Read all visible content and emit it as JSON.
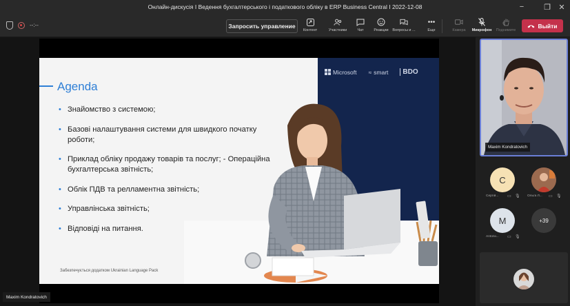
{
  "window": {
    "title": "Онлайн-дискусія І Ведення бухгалтерського і податкового обліку в ERP Business Central І 2022-12-08"
  },
  "toolbar": {
    "timer": "--:--",
    "take_control": "Запросить управление",
    "buttons": [
      {
        "label": "Контент",
        "icon": "share-content-icon"
      },
      {
        "label": "Участники",
        "icon": "people-icon"
      },
      {
        "label": "Чат",
        "icon": "chat-icon"
      },
      {
        "label": "Реакции",
        "icon": "reactions-icon"
      },
      {
        "label": "Вопросы и ...",
        "icon": "questions-icon"
      },
      {
        "label": "Еще",
        "icon": "more-icon"
      },
      {
        "label": "Камера",
        "icon": "camera-off-icon"
      },
      {
        "label": "Микрофон",
        "icon": "microphone-icon"
      },
      {
        "label": "Поднимите",
        "icon": "raise-hand-icon"
      }
    ],
    "leave": "Выйти"
  },
  "slide": {
    "title": "Agenda",
    "items": [
      "Знайомство з системою;",
      "Базові налаштування системи для швидкого початку роботи;",
      "Приклад обліку продажу товарів та послуг; - Операційна бухгалтерська звітність;",
      "Облік ПДВ та релламентна звітність;",
      "Управлінська звітність;",
      "Відповіді на питання."
    ],
    "footnote": "Забезпечується додатком Ukrainian Language Pack",
    "logos": [
      "Microsoft",
      "smart",
      "BDO"
    ]
  },
  "stage": {
    "presenter_name": "Maxim Kondratovich"
  },
  "right_panel": {
    "camera_name": "Maxim Kondratovich",
    "participants": [
      {
        "initial": "C",
        "name": "Сергій...",
        "color": "#f6e1b4"
      },
      {
        "initial": "",
        "name": "Ольга Л...",
        "color": "#7a4a3a"
      },
      {
        "initial": "M",
        "name": "Antonii...",
        "color": "#dde3ea"
      }
    ],
    "more_count": "+39"
  }
}
